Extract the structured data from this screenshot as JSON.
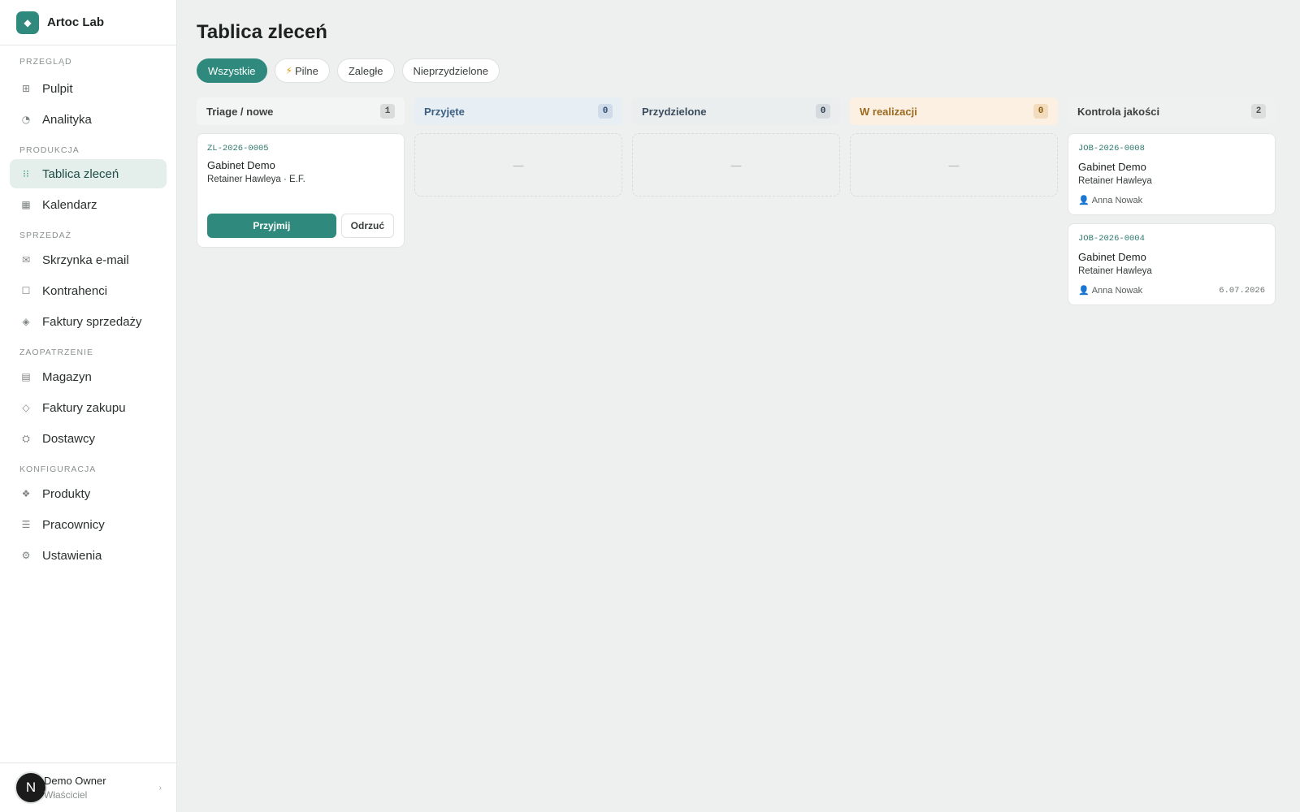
{
  "app": {
    "name": "Artoc Lab",
    "logo_icon": "diamond-icon",
    "accent_color": "#2f8a7d"
  },
  "sidebar": {
    "sections": [
      {
        "label": "PRZEGLĄD",
        "items": [
          {
            "label": "Pulpit",
            "icon": "grid-icon"
          },
          {
            "label": "Analityka",
            "icon": "pie-chart-icon"
          }
        ]
      },
      {
        "label": "PRODUKCJA",
        "items": [
          {
            "label": "Tablica zleceń",
            "icon": "board-icon",
            "active": true
          },
          {
            "label": "Kalendarz",
            "icon": "calendar-icon"
          }
        ]
      },
      {
        "label": "SPRZEDAŻ",
        "items": [
          {
            "label": "Skrzynka e-mail",
            "icon": "mail-icon"
          },
          {
            "label": "Kontrahenci",
            "icon": "contacts-icon"
          },
          {
            "label": "Faktury sprzedaży",
            "icon": "invoice-icon"
          }
        ]
      },
      {
        "label": "ZAOPATRZENIE",
        "items": [
          {
            "label": "Magazyn",
            "icon": "warehouse-icon"
          },
          {
            "label": "Faktury zakupu",
            "icon": "purchase-invoice-icon"
          },
          {
            "label": "Dostawcy",
            "icon": "supplier-icon"
          }
        ]
      },
      {
        "label": "KONFIGURACJA",
        "items": [
          {
            "label": "Produkty",
            "icon": "products-icon"
          },
          {
            "label": "Pracownicy",
            "icon": "staff-icon"
          },
          {
            "label": "Ustawienia",
            "icon": "settings-icon"
          }
        ]
      }
    ],
    "user": {
      "initial": "N",
      "name": "Demo Owner",
      "role": "Właściciel"
    }
  },
  "main": {
    "title": "Tablica zleceń",
    "filters": [
      {
        "label": "Wszystkie",
        "active": true
      },
      {
        "label": "Pilne",
        "icon": "lightning-icon"
      },
      {
        "label": "Zaległe"
      },
      {
        "label": "Nieprzydzielone"
      }
    ]
  },
  "board": {
    "columns": [
      {
        "title": "Triage / nowe",
        "count": "1",
        "color": "#3a403e"
      },
      {
        "title": "Przyjęte",
        "count": "0",
        "color": "#3d6082"
      },
      {
        "title": "Przydzielone",
        "count": "0",
        "color": "#3b4c5e"
      },
      {
        "title": "W realizacji",
        "count": "0",
        "color": "#9a6a1f"
      },
      {
        "title": "Kontrola jakości",
        "count": "2",
        "color": "#3a403e"
      }
    ],
    "empty_placeholder": "—",
    "triage_card": {
      "code": "ZL-2026-0005",
      "title": "Gabinet Demo",
      "subtitle": "Retainer Hawleya · E.F.",
      "accept_label": "Przyjmij",
      "reject_label": "Odrzuć"
    },
    "qc_cards": [
      {
        "code": "JOB-2026-0008",
        "title": "Gabinet Demo",
        "subtitle": "Retainer Hawleya",
        "assignee": "Anna Nowak",
        "date": ""
      },
      {
        "code": "JOB-2026-0004",
        "title": "Gabinet Demo",
        "subtitle": "Retainer Hawleya",
        "assignee": "Anna Nowak",
        "date": "6.07.2026"
      }
    ]
  }
}
